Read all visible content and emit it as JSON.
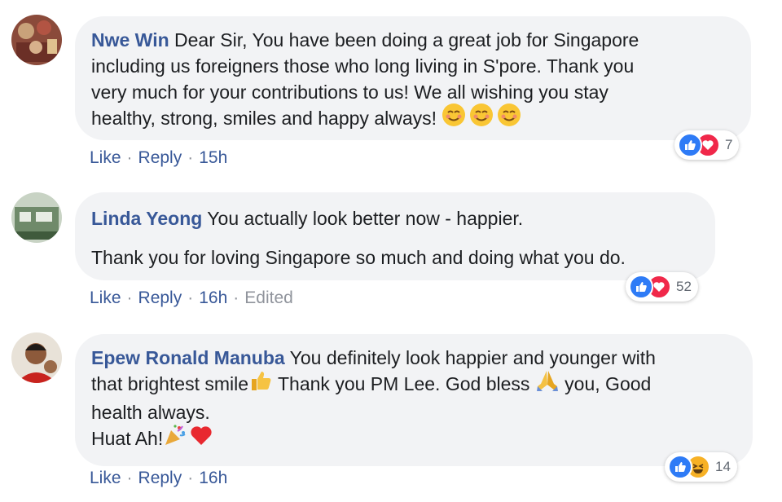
{
  "comments": [
    {
      "author": "Nwe Win",
      "text_lines": [
        " Dear Sir, You have been doing a great job for Singapore",
        "including us foreigners those who long living in S'pore. Thank you",
        "very much for your contributions to us! We all wishing you stay",
        "healthy, strong, smiles and happy always! "
      ],
      "trailing_emoji": [
        "smiling-face",
        "smiling-face",
        "smiling-face"
      ],
      "like_label": "Like",
      "reply_label": "Reply",
      "time": "15h",
      "reaction_count": "7",
      "reaction_types": [
        "like",
        "love"
      ]
    },
    {
      "author": "Linda Yeong",
      "text_lines": [
        " You actually look better now - happier.",
        "Thank you for loving Singapore so much and doing what you do."
      ],
      "like_label": "Like",
      "reply_label": "Reply",
      "time": "16h",
      "edited_label": "Edited",
      "reaction_count": "52",
      "reaction_types": [
        "like",
        "love"
      ]
    },
    {
      "author": "Epew Ronald Manuba",
      "text_lines": [
        " You definitely look happier and younger with",
        "that brightest smile",
        " Thank you PM Lee. God bless ",
        " you, Good",
        "health always.",
        "Huat Ah!"
      ],
      "inline_emoji": [
        "thumbs-up",
        "folded-hands",
        "party-popper",
        "red-heart"
      ],
      "like_label": "Like",
      "reply_label": "Reply",
      "time": "16h",
      "reaction_count": "14",
      "reaction_types": [
        "like",
        "haha"
      ]
    }
  ],
  "separator": "·",
  "colors": {
    "author": "#385898",
    "bubble": "#f2f3f5",
    "meta": "#90949c",
    "like": "#2e7bf6",
    "love": "#f0284a",
    "haha": "#f7b125"
  }
}
